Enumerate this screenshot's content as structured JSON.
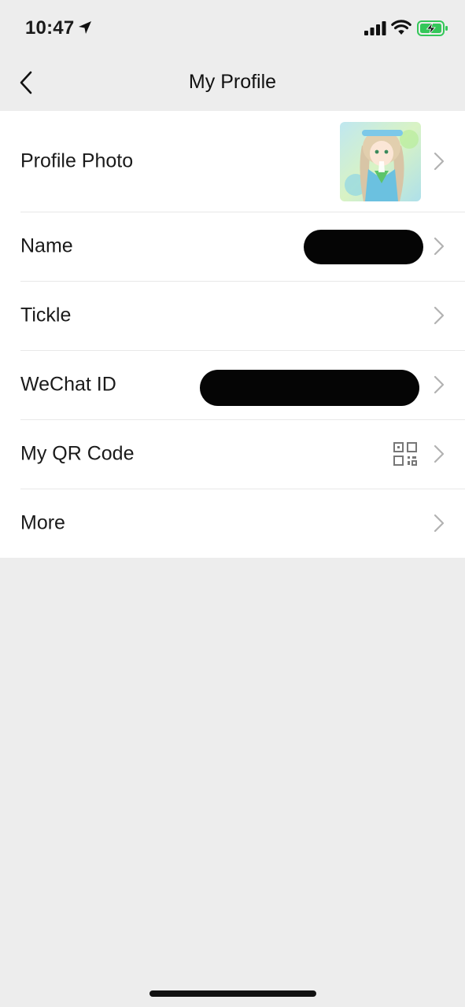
{
  "status_bar": {
    "time": "10:47",
    "icons": [
      "location-arrow-icon",
      "signal-icon",
      "wifi-icon",
      "battery-charging-icon"
    ],
    "battery_color": "#34c759"
  },
  "nav": {
    "title": "My Profile",
    "back_icon": "chevron-left-icon"
  },
  "rows": [
    {
      "label": "Profile Photo",
      "accessory": "avatar-image"
    },
    {
      "label": "Name",
      "value_redacted": true
    },
    {
      "label": "Tickle"
    },
    {
      "label": "WeChat ID",
      "value_redacted": true
    },
    {
      "label": "My QR Code",
      "accessory": "qr-code-icon"
    },
    {
      "label": "More"
    }
  ],
  "colors": {
    "background": "#ededed",
    "card": "#ffffff",
    "separator": "#e8e8e8",
    "chevron": "#b2b2b2"
  }
}
